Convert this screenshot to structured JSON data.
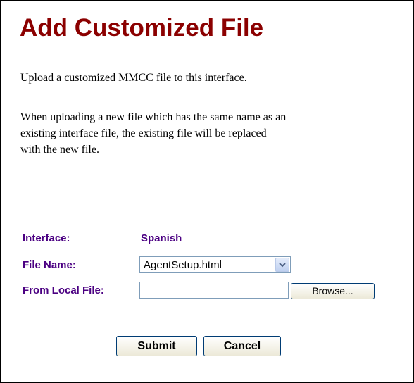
{
  "page": {
    "title": "Add Customized File",
    "intro": "Upload a customized MMCC file to this interface.",
    "note_lines": [
      "When uploading a new file which has the same name as an",
      "existing interface file, the existing file will be replaced",
      "with the new file."
    ]
  },
  "form": {
    "interface_label": "Interface:",
    "interface_value": "Spanish",
    "file_name_label": "File Name:",
    "file_name_selected": "AgentSetup.html",
    "local_file_label": "From Local File:",
    "local_file_value": "",
    "browse_label": "Browse..."
  },
  "actions": {
    "submit_label": "Submit",
    "cancel_label": "Cancel"
  },
  "colors": {
    "title": "#8b0000",
    "label": "#4b0082",
    "border": "#000000"
  },
  "icons": {
    "dropdown": "chevron-down-icon"
  }
}
